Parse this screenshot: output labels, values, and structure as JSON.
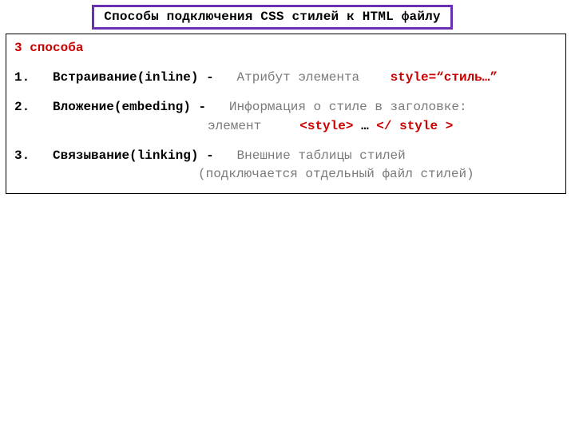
{
  "title": "Способы подключения CSS стилей к HTML файлу",
  "heading": "3 способа",
  "items": [
    {
      "num": "1.",
      "label": "Встраивание(inline)",
      "dash": "-",
      "desc": "Атрибут элемента",
      "code": "style=“стиль…”"
    },
    {
      "num": "2.",
      "label": "Вложение(embeding)",
      "dash": " -",
      "desc": "Информация о стиле в заголовке:",
      "line2_prefix": "элемент",
      "code_open": "<style>",
      "code_mid": " … ",
      "code_close": "</ style >"
    },
    {
      "num": "3.",
      "label": "Связывание(linking)",
      "dash": "-",
      "desc": "Внешние таблицы стилей",
      "line2": "(подключается отдельный файл стилей)"
    }
  ]
}
